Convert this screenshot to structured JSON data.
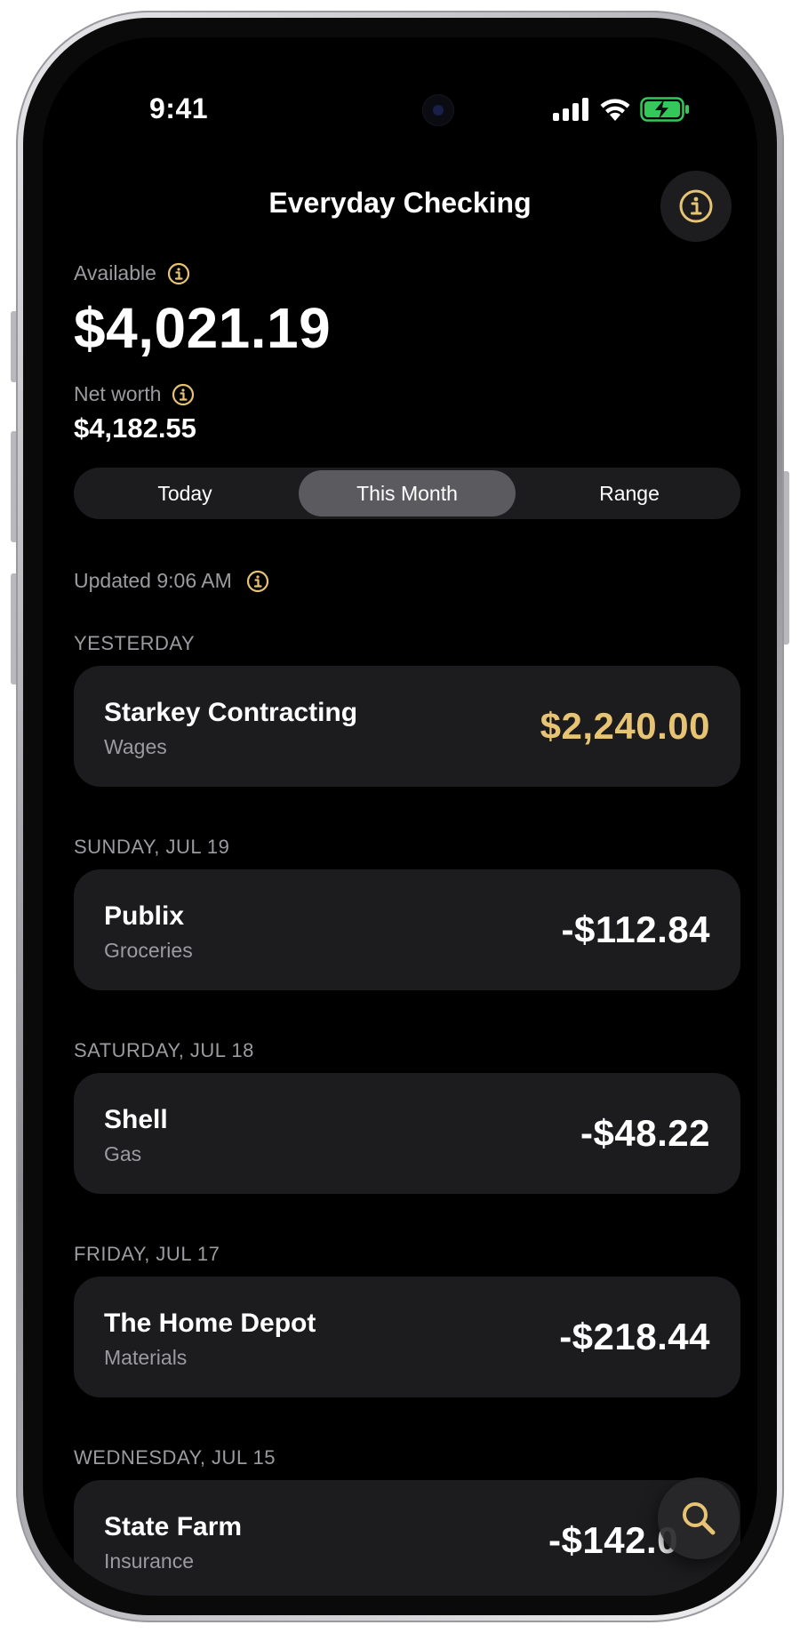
{
  "status": {
    "time": "9:41"
  },
  "header": {
    "title": "Everyday Checking"
  },
  "balance": {
    "available_label": "Available",
    "available_amount": "$4,021.19",
    "net_worth_label": "Net worth",
    "net_worth_amount": "$4,182.55"
  },
  "segments": [
    {
      "label": "Today",
      "selected": false
    },
    {
      "label": "This Month",
      "selected": true
    },
    {
      "label": "Range",
      "selected": false
    }
  ],
  "updated": "Updated 9:06 AM",
  "groups": [
    {
      "date": "YESTERDAY",
      "merchant": "Starkey Contracting",
      "category": "Wages",
      "amount": "$2,240.00",
      "positive": true
    },
    {
      "date": "SUNDAY, JUL 19",
      "merchant": "Publix",
      "category": "Groceries",
      "amount": "-$112.84",
      "positive": false
    },
    {
      "date": "SATURDAY, JUL 18",
      "merchant": "Shell",
      "category": "Gas",
      "amount": "-$48.22",
      "positive": false
    },
    {
      "date": "FRIDAY, JUL 17",
      "merchant": "The Home Depot",
      "category": "Materials",
      "amount": "-$218.44",
      "positive": false
    },
    {
      "date": "WEDNESDAY, JUL 15",
      "merchant": "State Farm",
      "category": "Insurance",
      "amount": "-$142.0",
      "positive": false
    }
  ],
  "colors": {
    "accent": "#e7c374",
    "background": "#000000",
    "card": "#1c1c1e",
    "battery": "#34c759"
  },
  "icons": {
    "header_info": "info-icon",
    "search": "search-icon"
  }
}
